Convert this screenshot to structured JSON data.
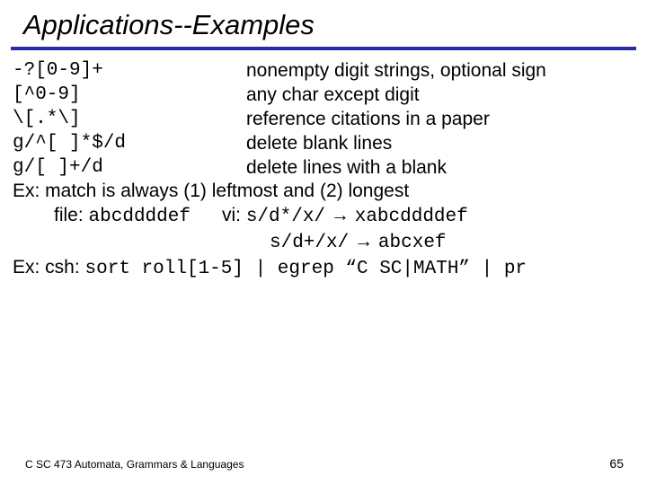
{
  "title": "Applications--Examples",
  "rows": [
    {
      "pattern": "-?[0-9]+",
      "desc": "nonempty digit strings, optional sign"
    },
    {
      "pattern": "[^0-9]",
      "desc": "any char except digit"
    },
    {
      "pattern": "\\[.*\\]",
      "desc": "reference citations in a paper"
    },
    {
      "pattern": "g/^[ ]*$/d",
      "desc": "delete blank lines"
    },
    {
      "pattern": "g/[ ]+/d",
      "desc": "delete lines with a blank"
    }
  ],
  "ex1": {
    "prefix": "Ex:  match is always (1) leftmost and (2) longest"
  },
  "ex2": {
    "file_label": "file:",
    "file_val": "abcddddef",
    "vi_label": "vi:",
    "sub1_cmd": "s/d*/x/",
    "sub1_res": "xabcddddef",
    "sub2_cmd": "s/d+/x/",
    "sub2_res": "abcxef"
  },
  "ex3": {
    "prefix": "Ex:  csh:",
    "cmd": "sort roll[1-5] | egrep “C SC|MATH” | pr"
  },
  "footer": {
    "left": "C SC 473 Automata, Grammars & Languages",
    "page": "65"
  }
}
